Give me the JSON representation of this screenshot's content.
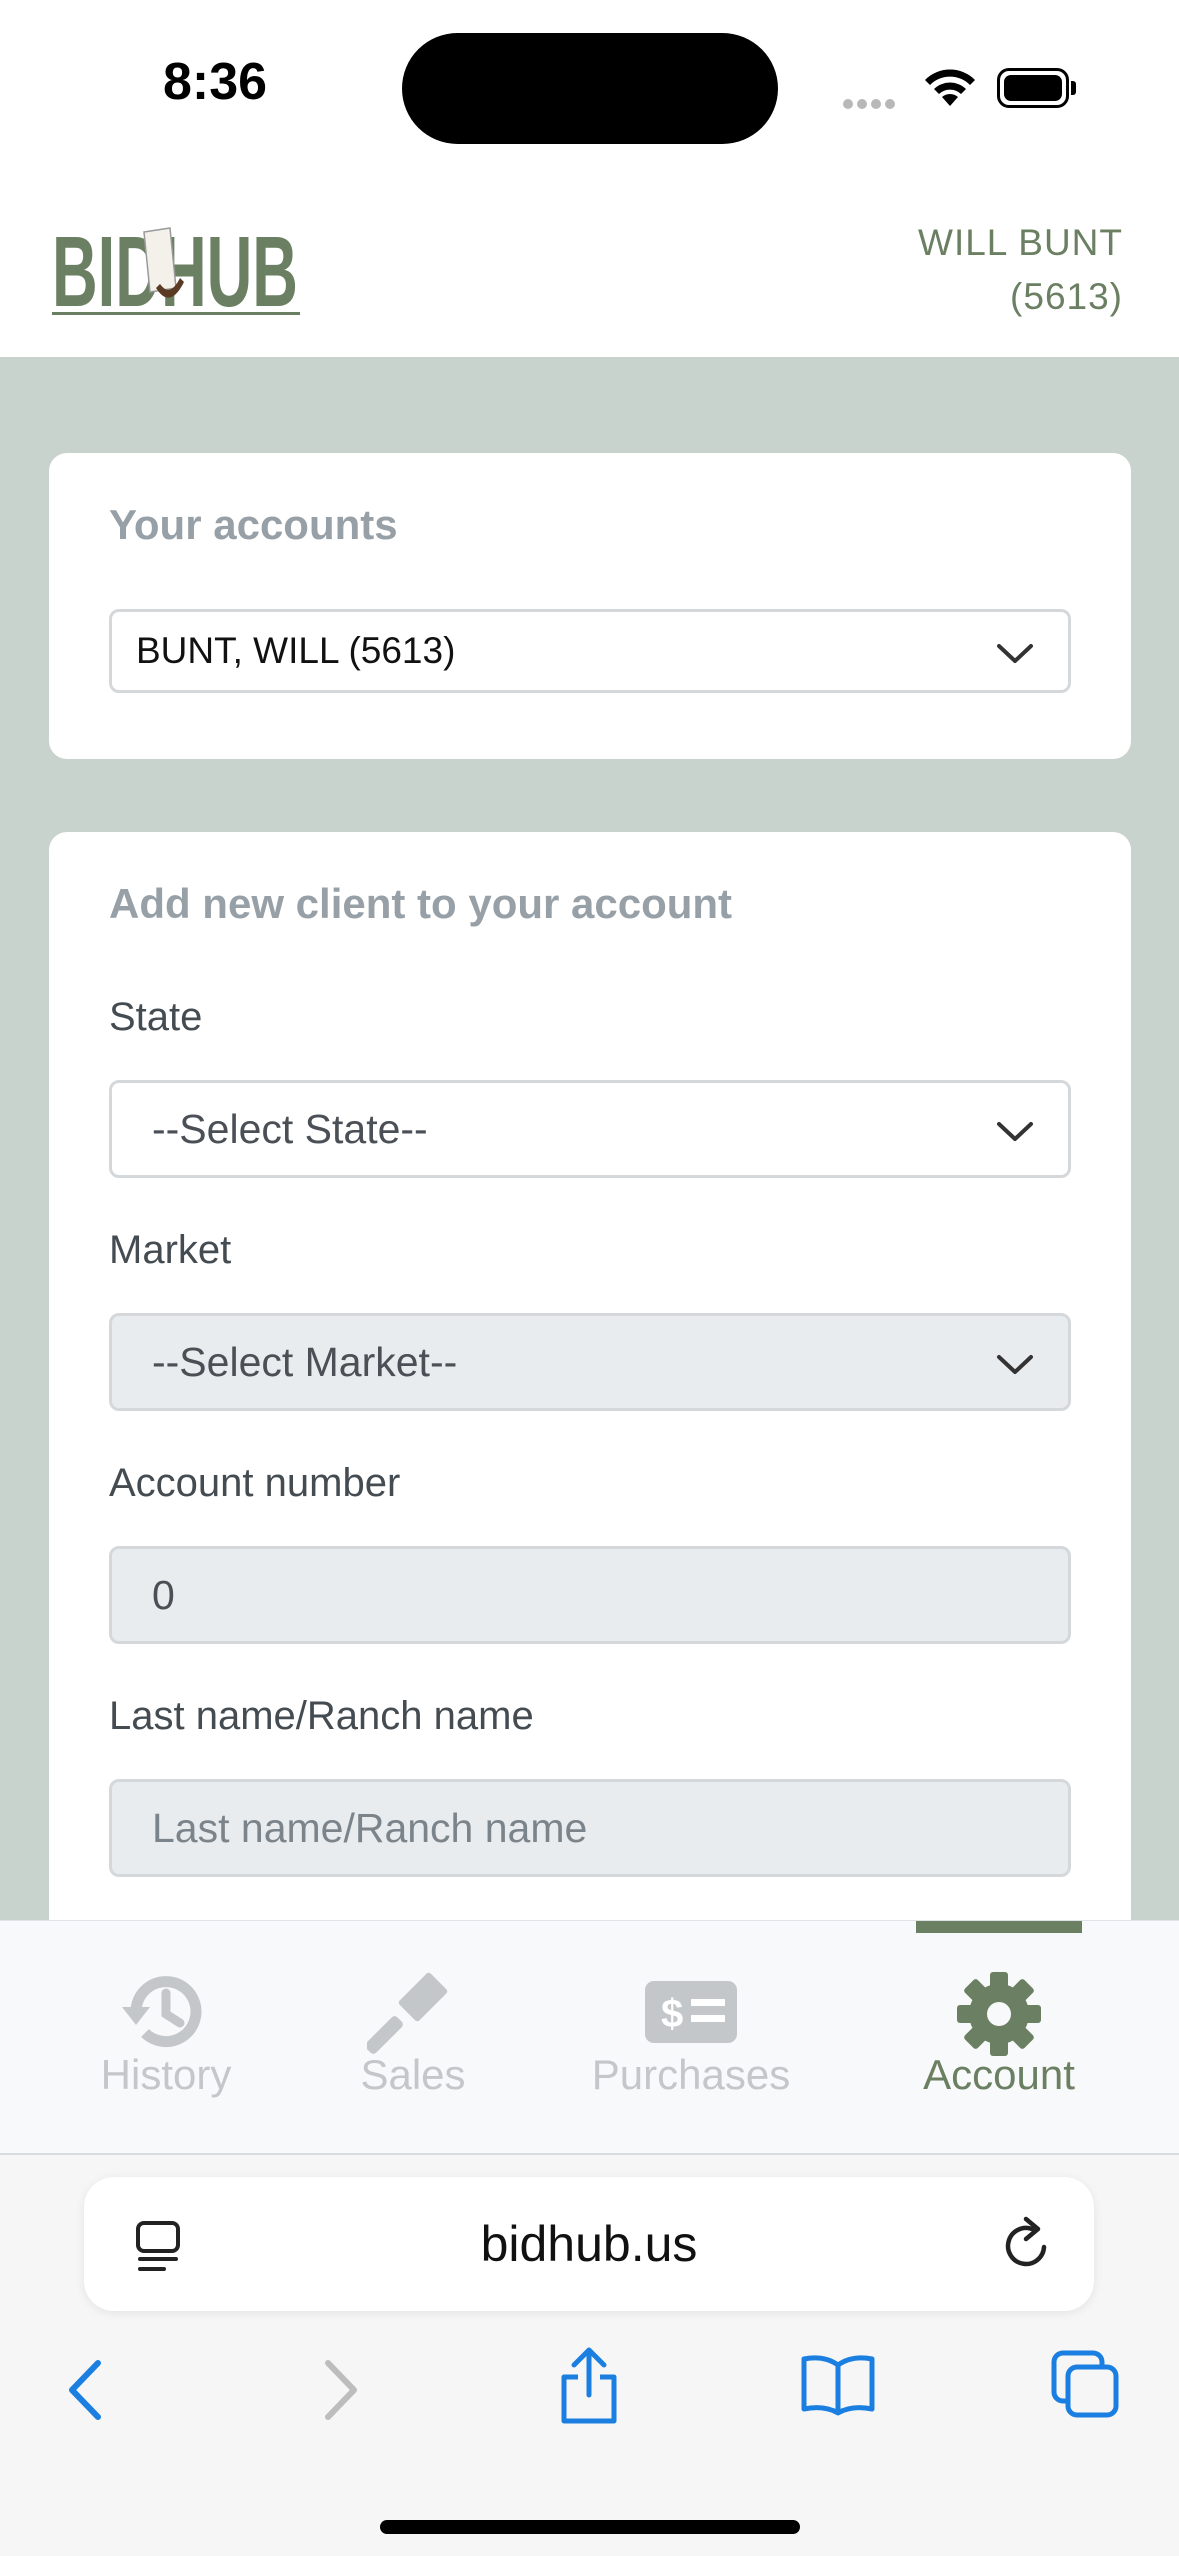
{
  "status_bar": {
    "time": "8:36"
  },
  "header": {
    "logo_text": "BIDHUB",
    "user_name": "WILL BUNT",
    "user_id": "(5613)"
  },
  "accounts_card": {
    "title": "Your accounts",
    "selected_account": "BUNT, WILL (5613)"
  },
  "add_client_card": {
    "title": "Add new client to your account",
    "state_label": "State",
    "state_value": "--Select State--",
    "market_label": "Market",
    "market_value": "--Select Market--",
    "account_number_label": "Account number",
    "account_number_value": "0",
    "last_name_label": "Last name/Ranch name",
    "last_name_placeholder": "Last name/Ranch name"
  },
  "tabs": [
    {
      "label": "History",
      "icon": "history-icon",
      "active": false
    },
    {
      "label": "Sales",
      "icon": "gavel-icon",
      "active": false
    },
    {
      "label": "Purchases",
      "icon": "money-bill-icon",
      "active": false
    },
    {
      "label": "Account",
      "icon": "gear-icon",
      "active": true
    }
  ],
  "browser": {
    "url": "bidhub.us"
  },
  "colors": {
    "brand": "#6b7f62",
    "page_background": "#c9d3ce",
    "inactive_tab": "#c4c7ca",
    "safari_blue": "#1a7fe0"
  }
}
